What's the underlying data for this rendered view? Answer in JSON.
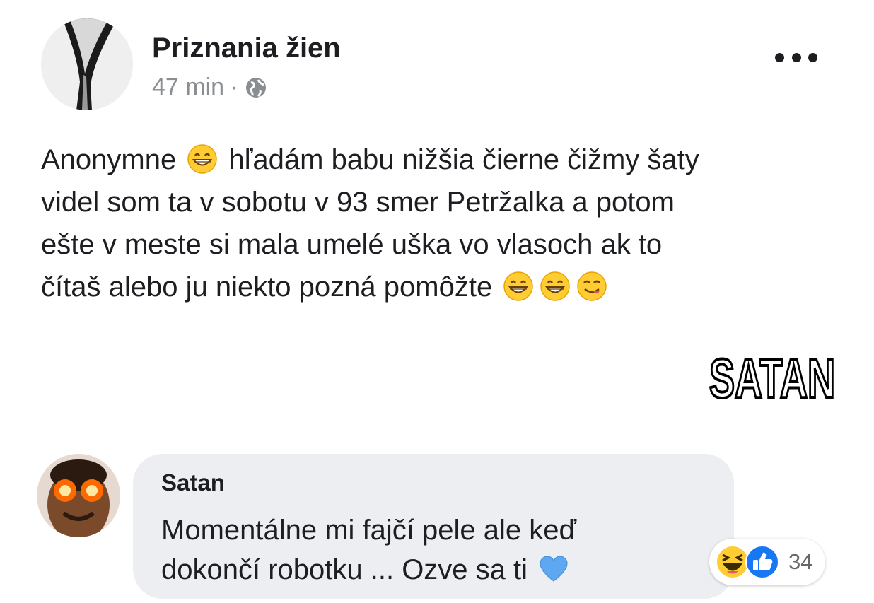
{
  "post": {
    "page_name": "Priznania žien",
    "time": "47 min",
    "separator": "·",
    "privacy_icon": "globe-icon",
    "more_icon": "more-options-icon",
    "body": {
      "line1_a": "Anonymne",
      "line1_b": "hľadám babu nižšia čierne čižmy šaty",
      "line2": "videl som ta v sobotu v 93 smer Petržalka a potom",
      "line3": "ešte v meste si mala umelé uška vo vlasoch ak to",
      "line4": "čítaš alebo ju niekto pozná pomôžte"
    },
    "emojis": [
      "grinning-face-emoji",
      "grinning-face-emoji",
      "grinning-face-emoji",
      "face-savoring-food-emoji"
    ]
  },
  "watermark": {
    "text": "SATAN"
  },
  "comment": {
    "author": "Satan",
    "line1": "Momentálne mi fajčí pele ale keď",
    "line2": "dokončí robotku ... Ozve sa ti",
    "emoji": "blue-heart-emoji",
    "reactions": {
      "icons": [
        "haha-reaction-icon",
        "like-reaction-icon"
      ],
      "count": "34"
    }
  },
  "colors": {
    "text": "#1c1e21",
    "meta": "#8a8d91",
    "bubble": "#eceef1",
    "like_blue": "#1877f2",
    "emoji_yellow": "#ffcc33",
    "heart_blue": "#5da8f0"
  }
}
